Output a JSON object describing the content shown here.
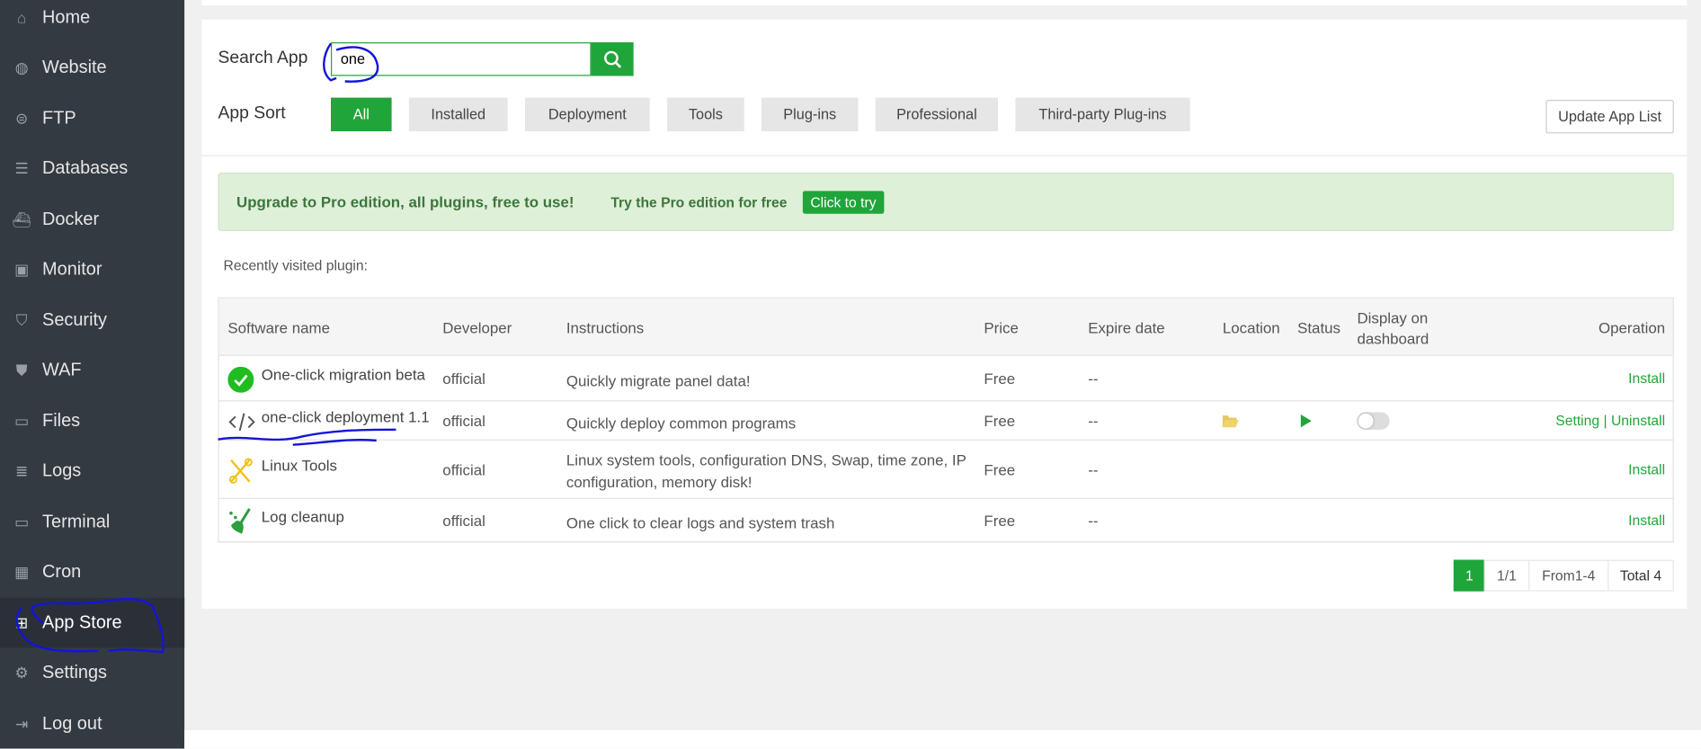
{
  "sidebar": {
    "items": [
      {
        "label": "Home",
        "icon": "home-icon"
      },
      {
        "label": "Website",
        "icon": "globe-icon"
      },
      {
        "label": "FTP",
        "icon": "ftp-icon"
      },
      {
        "label": "Databases",
        "icon": "database-icon"
      },
      {
        "label": "Docker",
        "icon": "docker-icon"
      },
      {
        "label": "Monitor",
        "icon": "monitor-icon"
      },
      {
        "label": "Security",
        "icon": "shield-icon"
      },
      {
        "label": "WAF",
        "icon": "waf-shield-icon"
      },
      {
        "label": "Files",
        "icon": "folder-icon"
      },
      {
        "label": "Logs",
        "icon": "logs-icon"
      },
      {
        "label": "Terminal",
        "icon": "terminal-icon"
      },
      {
        "label": "Cron",
        "icon": "calendar-icon"
      },
      {
        "label": "App Store",
        "icon": "grid-icon",
        "active": true
      },
      {
        "label": "Settings",
        "icon": "gear-icon"
      },
      {
        "label": "Log out",
        "icon": "logout-icon"
      }
    ]
  },
  "search": {
    "label": "Search App",
    "value": "one"
  },
  "sort": {
    "label": "App Sort",
    "options": [
      "All",
      "Installed",
      "Deployment",
      "Tools",
      "Plug-ins",
      "Professional",
      "Third-party Plug-ins"
    ],
    "selected": "All"
  },
  "update_button": "Update App List",
  "banner": {
    "text": "Upgrade to Pro edition, all plugins, free to use!",
    "try_text": "Try the Pro edition for free",
    "button": "Click to try"
  },
  "recent_label": "Recently visited plugin:",
  "table": {
    "headers": {
      "name": "Software name",
      "developer": "Developer",
      "instructions": "Instructions",
      "price": "Price",
      "expire": "Expire date",
      "location": "Location",
      "status": "Status",
      "display": "Display on dashboard",
      "operation": "Operation"
    },
    "rows": [
      {
        "name": "One-click migration beta",
        "developer": "official",
        "instructions": "Quickly migrate panel data!",
        "price": "Free",
        "expire": "--",
        "operation": "Install"
      },
      {
        "name": "one-click deployment 1.1",
        "developer": "official",
        "instructions": "Quickly deploy common programs",
        "price": "Free",
        "expire": "--",
        "op_setting": "Setting",
        "op_sep": "|",
        "op_uninstall": "Uninstall",
        "display_on_dashboard": false
      },
      {
        "name": "Linux Tools",
        "developer": "official",
        "instructions": "Linux system tools, configuration DNS, Swap, time zone, IP configuration, memory disk!",
        "price": "Free",
        "expire": "--",
        "operation": "Install"
      },
      {
        "name": "Log cleanup",
        "developer": "official",
        "instructions": "One click to clear logs and system trash",
        "price": "Free",
        "expire": "--",
        "operation": "Install"
      }
    ]
  },
  "pagination": {
    "current": "1",
    "pages": "1/1",
    "range": "From1-4",
    "total": "Total 4"
  },
  "colors": {
    "accent": "#20a53a",
    "sidebar": "#343a42",
    "banner": "#dff0d8"
  }
}
